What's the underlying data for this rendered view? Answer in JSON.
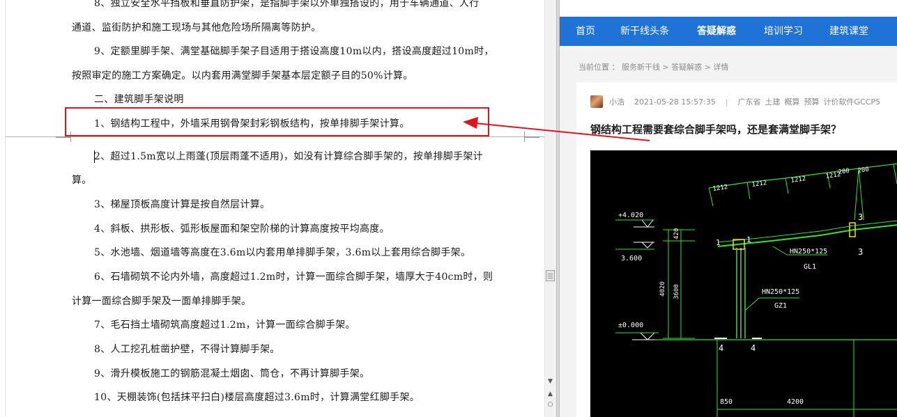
{
  "document": {
    "lines": [
      "8、独立安全水平挡板和垂直防护架，是指脚手架以外单独搭设的，用于车辆通道、人行",
      "通道、监街防护和施工现场与其他危险场所隔离等防护。",
      "9、定额里脚手架、满堂基础脚手架子目适用于搭设高度10m以内，搭设高度超过10m时，",
      "按照审定的施工方案确定。以内套用满堂脚手架基本层定额子目的50%计算。",
      "二、建筑脚手架说明",
      "1、钢结构工程中，外墙采用钢骨架封彩钢板结构，按单排脚手架计算。",
      "2、超过1.5m宽以上雨蓬(顶层雨蓬不适用)，如没有计算综合脚手架的，按单排脚手架计",
      "算。",
      "3、梯屋顶板高度计算是按自然层计算。",
      "4、斜板、拱形板、弧形板屋面和架空阶梯的计算高度按平均高度。",
      "5、水池墙、烟道墙等高度在3.6m以内套用单排脚手架，3.6m以上套用综合脚手架。",
      "6、石墙砌筑不论内外墙，高度超过1.2m时，计算一面综合脚手架，墙厚大于40cm时，则",
      "计算一面综合脚手架及一面单排脚手架。",
      "7、毛石挡土墙砌筑高度超过1.2m，计算一面综合脚手架。",
      "8、人工挖孔桩凿护壁，不得计算脚手架。",
      "9、滑升模板施工的钢筋混凝土烟囱、筒仓，不再计算脚手架。",
      "10、天棚装饰(包括抹平扫白)楼层高度超过3.6m时，计算满堂红脚手架。"
    ]
  },
  "scrollbar": {
    "up_glyph": "▲",
    "down_glyph": "▼",
    "circle_glyph": "○"
  },
  "website": {
    "nav": [
      "首页",
      "新干线头条",
      "答疑解惑",
      "培训学习",
      "建筑课堂"
    ],
    "active_nav": "答疑解惑",
    "breadcrumb": "当前位置 ： 服务新干线 > 答疑解惑 > 详情",
    "post": {
      "author": "小浩",
      "datetime": "2021-05-28 15:57:35",
      "separator": "|",
      "tags": [
        "广东省",
        "土建",
        "概算",
        "预算",
        "计价软件GCCP5"
      ],
      "title": "钢结构工程需要套综合脚手架吗，还是套满堂脚手架？"
    },
    "drawing_labels": {
      "elev_top": "+4.020",
      "elev_mid": "3.600",
      "elev_zero": "±0.000",
      "dim_420": "420",
      "dim_4020": "4020",
      "dim_3600": "3600",
      "beam": "HN250*125",
      "beam_id": "GL1",
      "column": "HN250*125",
      "column_id": "GZ1",
      "span_1212": "1212",
      "span_200": "200",
      "axis_3": "3",
      "axis_4": "4",
      "axis_1": "1",
      "bottom_850": "850",
      "bottom_4200": "4200"
    }
  },
  "colors": {
    "nav_bg": "#1f72d6",
    "highlight": "#e0141e",
    "cad_line": "#2ee62e",
    "cad_yellow": "#f4e200"
  }
}
